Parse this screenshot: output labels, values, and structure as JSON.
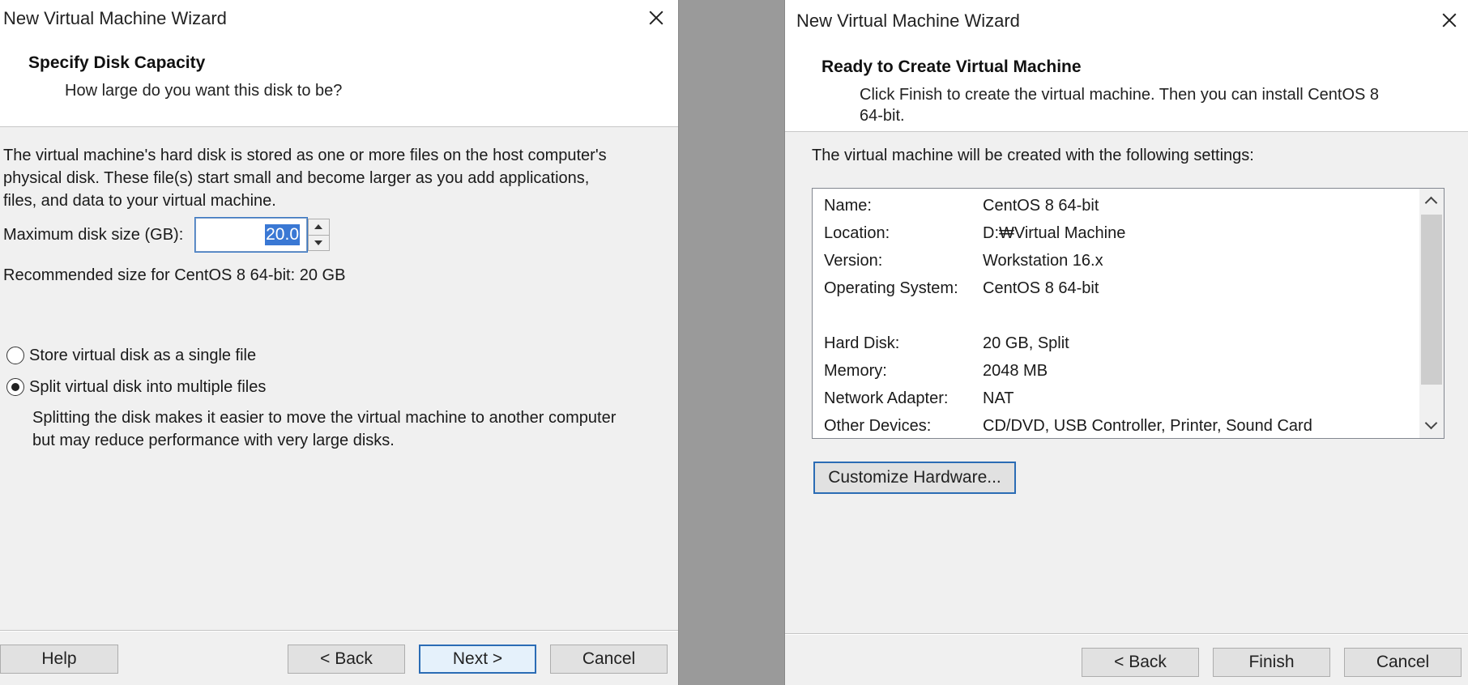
{
  "left_window": {
    "title": "New Virtual Machine Wizard",
    "header_title": "Specify Disk Capacity",
    "header_subtitle": "How large do you want this disk to be?",
    "description_lines": [
      "The virtual machine's hard disk is stored as one or more files on the host computer's",
      "physical disk. These file(s) start small and become larger as you add applications,",
      "files, and data to your virtual machine."
    ],
    "max_disk_label": "Maximum disk size (GB):",
    "max_disk_value": "20.0",
    "recommended": "Recommended size for CentOS 8 64-bit: 20 GB",
    "radio_single": "Store virtual disk as a single file",
    "radio_split": "Split virtual disk into multiple files",
    "selected_option": "split",
    "split_help_lines": [
      "Splitting the disk makes it easier to move the virtual machine to another computer",
      "but may reduce performance with very large disks."
    ],
    "buttons": {
      "help": "Help",
      "back": "< Back",
      "next": "Next >",
      "cancel": "Cancel"
    }
  },
  "right_window": {
    "title": "New Virtual Machine Wizard",
    "header_title": "Ready to Create Virtual Machine",
    "header_subtitle_lines": [
      "Click Finish to create the virtual machine. Then you can install CentOS 8",
      "64-bit."
    ],
    "intro": "The virtual machine will be created with the following settings:",
    "settings": [
      {
        "key": "Name:",
        "value": "CentOS 8 64-bit"
      },
      {
        "key": "Location:",
        "value": "D:₩Virtual Machine"
      },
      {
        "key": "Version:",
        "value": "Workstation 16.x"
      },
      {
        "key": "Operating System:",
        "value": "CentOS 8 64-bit"
      },
      {
        "key": "Hard Disk:",
        "value": "20 GB, Split"
      },
      {
        "key": "Memory:",
        "value": "2048 MB"
      },
      {
        "key": "Network Adapter:",
        "value": "NAT"
      },
      {
        "key": "Other Devices:",
        "value": "CD/DVD, USB Controller, Printer, Sound Card"
      }
    ],
    "customize_button": "Customize Hardware...",
    "buttons": {
      "back": "< Back",
      "finish": "Finish",
      "cancel": "Cancel"
    }
  },
  "colors": {
    "desktop_gap": "#9a9a9a",
    "window_bg": "#f0f0f0",
    "header_bg": "#ffffff",
    "focus_blue": "#2b6cb5",
    "selection_blue": "#3a78d4"
  }
}
